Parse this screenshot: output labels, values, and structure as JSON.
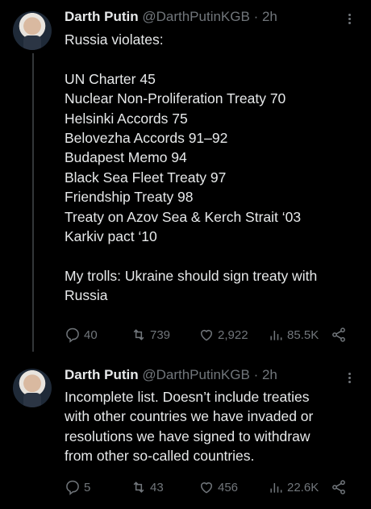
{
  "tweets": [
    {
      "name": "Darth Putin",
      "handle": "@DarthPutinKGB",
      "time": "· 2h",
      "lines": [
        "Russia violates:",
        "",
        "UN Charter 45",
        "Nuclear Non-Proliferation Treaty 70",
        "Helsinki Accords 75",
        "Belovezha Accords 91–92",
        "Budapest Memo 94",
        "Black Sea Fleet Treaty 97",
        "Friendship Treaty 98",
        "Treaty on Azov Sea & Kerch Strait ‘03",
        "Karkiv pact ‘10",
        "",
        "My trolls: Ukraine should sign treaty with",
        "Russia"
      ],
      "stats": {
        "replies": "40",
        "retweets": "739",
        "likes": "2,922",
        "views": "85.5K"
      }
    },
    {
      "name": "Darth Putin",
      "handle": "@DarthPutinKGB",
      "time": "· 2h",
      "lines": [
        "Incomplete list. Doesn’t include treaties",
        "with other countries we have invaded or",
        "resolutions we have signed to withdraw",
        "from other so-called countries."
      ],
      "stats": {
        "replies": "5",
        "retweets": "43",
        "likes": "456",
        "views": "22.6K"
      }
    }
  ],
  "icons": {
    "reply": "reply-icon",
    "retweet": "retweet-icon",
    "like": "heart-icon",
    "views": "views-icon",
    "share": "share-icon",
    "more": "more-icon"
  },
  "colors": {
    "background": "#000000",
    "text": "#e7e9ea",
    "muted": "#71767b",
    "thread": "#333639"
  }
}
